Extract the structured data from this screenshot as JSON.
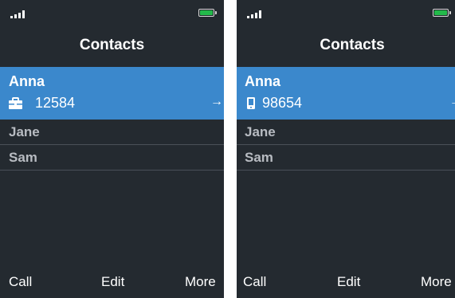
{
  "colors": {
    "background": "#242a30",
    "selection": "#3b88cc",
    "battery": "#23b94a",
    "dim_text": "#b8bcc2"
  },
  "screens": [
    {
      "status": {
        "signal_icon": "signal-bars-icon",
        "battery_icon": "battery-icon"
      },
      "title": "Contacts",
      "selected": {
        "name": "Anna",
        "number": "12584",
        "number_icon": "briefcase-icon",
        "arrow": "→"
      },
      "contacts": [
        {
          "name": "Jane"
        },
        {
          "name": "Sam"
        }
      ],
      "softkeys": {
        "left": "Call",
        "center": "Edit",
        "right": "More"
      }
    },
    {
      "status": {
        "signal_icon": "signal-bars-icon",
        "battery_icon": "battery-icon"
      },
      "title": "Contacts",
      "selected": {
        "name": "Anna",
        "number": "98654",
        "number_icon": "mobile-phone-icon",
        "arrow": "→"
      },
      "contacts": [
        {
          "name": "Jane"
        },
        {
          "name": "Sam"
        }
      ],
      "softkeys": {
        "left": "Call",
        "center": "Edit",
        "right": "More"
      }
    }
  ]
}
